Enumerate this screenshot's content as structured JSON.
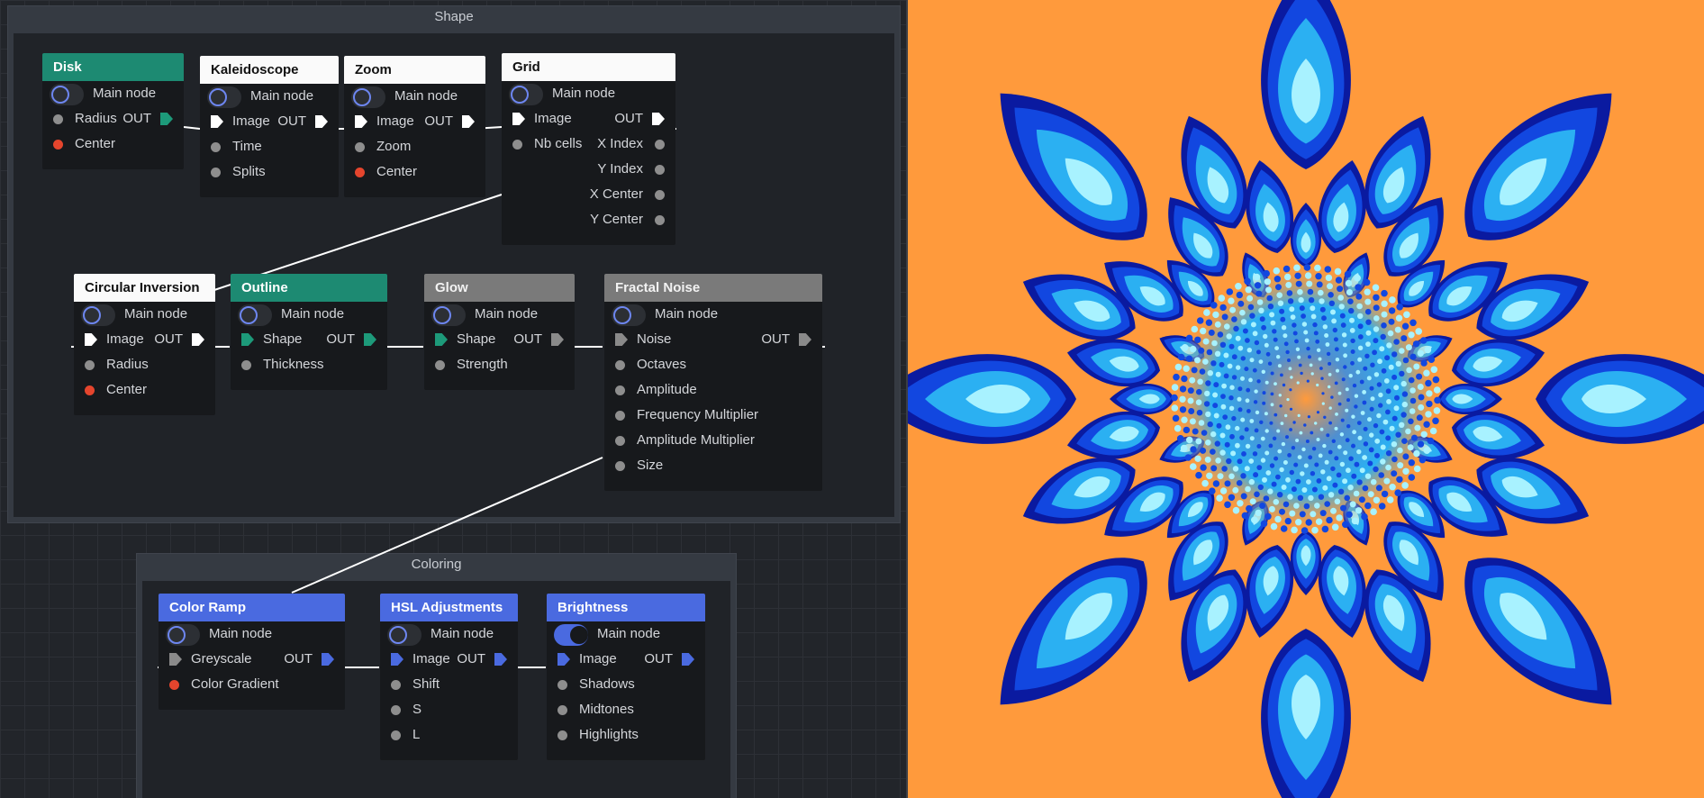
{
  "groups": {
    "shape": {
      "title": "Shape"
    },
    "coloring": {
      "title": "Coloring"
    }
  },
  "main_node_label": "Main node",
  "out_label": "OUT",
  "nodes": {
    "disk": {
      "title": "Disk",
      "inputs": [
        "Radius",
        "Center"
      ]
    },
    "kaleidoscope": {
      "title": "Kaleidoscope",
      "inputs": [
        "Image",
        "Time",
        "Splits"
      ]
    },
    "zoom": {
      "title": "Zoom",
      "inputs": [
        "Image",
        "Zoom",
        "Center"
      ]
    },
    "grid": {
      "title": "Grid",
      "inputs": [
        "Image",
        "Nb cells"
      ],
      "outputs": [
        "X Index",
        "Y Index",
        "X Center",
        "Y Center"
      ]
    },
    "circular_inversion": {
      "title": "Circular Inversion",
      "inputs": [
        "Image",
        "Radius",
        "Center"
      ]
    },
    "outline": {
      "title": "Outline",
      "inputs": [
        "Shape",
        "Thickness"
      ]
    },
    "glow": {
      "title": "Glow",
      "inputs": [
        "Shape",
        "Strength"
      ]
    },
    "fractal_noise": {
      "title": "Fractal Noise",
      "inputs": [
        "Noise",
        "Octaves",
        "Amplitude",
        "Frequency Multiplier",
        "Amplitude Multiplier",
        "Size"
      ]
    },
    "color_ramp": {
      "title": "Color Ramp",
      "inputs": [
        "Greyscale",
        "Color Gradient"
      ]
    },
    "hsl_adjustments": {
      "title": "HSL Adjustments",
      "inputs": [
        "Image",
        "Shift",
        "S",
        "L"
      ]
    },
    "brightness": {
      "title": "Brightness",
      "inputs": [
        "Image",
        "Shadows",
        "Midtones",
        "Highlights"
      ],
      "main_node_active": true
    }
  },
  "colors": {
    "accent_teal": "#1d8a72",
    "accent_blue": "#4a6ae0",
    "center_red": "#e5452d",
    "preview_bg": "#ff9a3c",
    "preview_light": "#a8f2ff",
    "preview_mid": "#2bb0f2",
    "preview_dark": "#1247e0",
    "preview_navy": "#0a1aa0"
  }
}
